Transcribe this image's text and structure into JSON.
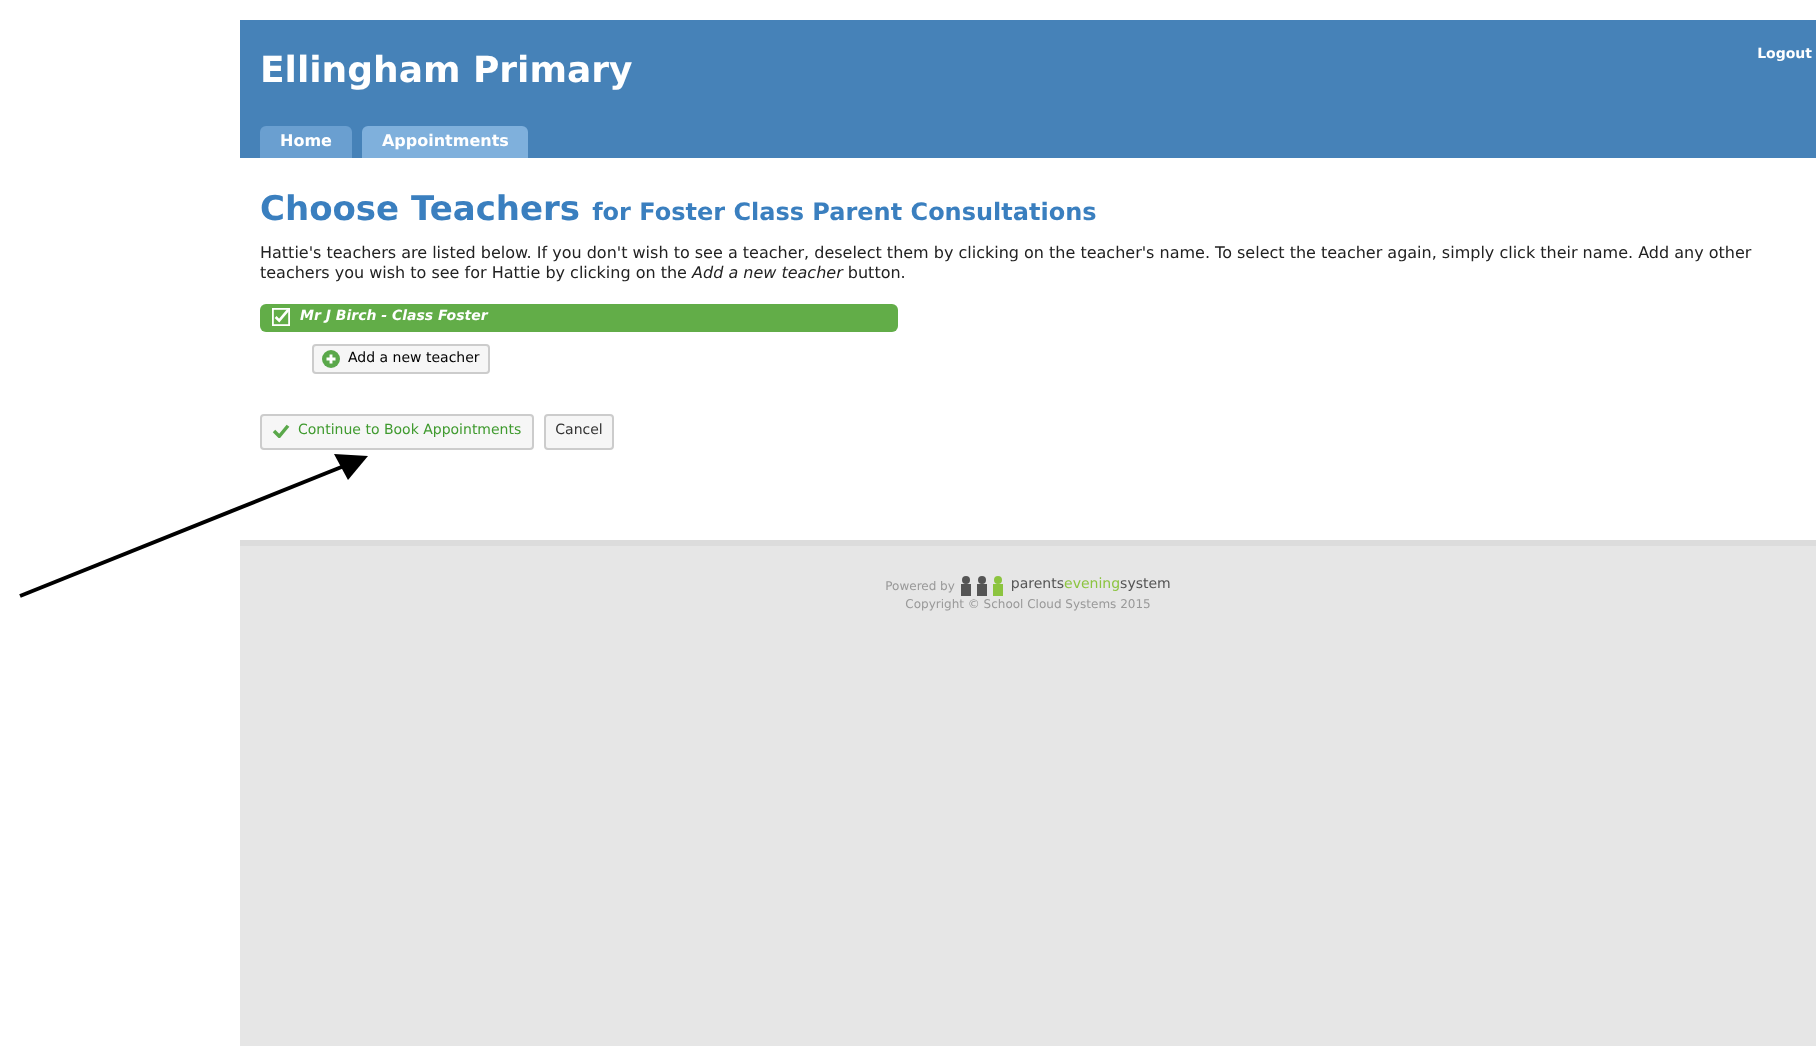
{
  "header": {
    "title": "Ellingham Primary",
    "logout": "Logout"
  },
  "tabs": [
    {
      "label": "Home",
      "selected": false
    },
    {
      "label": "Appointments",
      "selected": true
    }
  ],
  "heading": {
    "title": "Choose Teachers",
    "subtitle": "for Foster Class Parent Consultations"
  },
  "intro": "Hattie's teachers are listed below. If you don't wish to see a teacher, deselect them by clicking on the teacher's name. To select the teacher again, simply click their name.  Add any other teachers you wish to see for Hattie by clicking on the *Add a new teacher* button.",
  "teachers": [
    {
      "name": "Mr J Birch - Class Foster",
      "checked": true
    }
  ],
  "add_button": "Add a new teacher",
  "buttons": [
    {
      "label": "Continue to Book Appointments",
      "kind": "primary"
    },
    {
      "label": "Cancel",
      "kind": "plain"
    }
  ],
  "footer": {
    "powered_by": "Powered by",
    "logo_parts": [
      "parents",
      "evening",
      "system"
    ],
    "copyright": "Copyright © School Cloud Systems 2015"
  }
}
